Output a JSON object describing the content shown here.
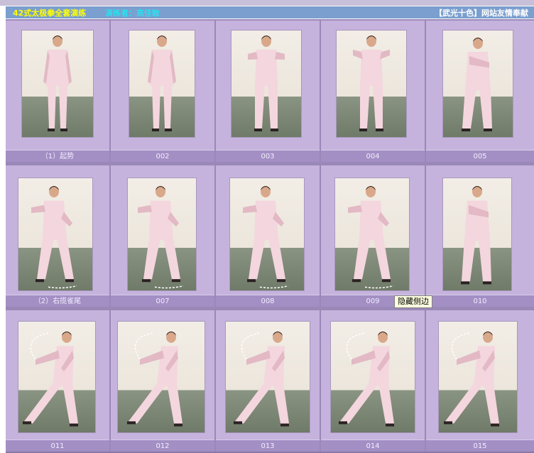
{
  "header": {
    "title": "42式太极拳全套演练",
    "performer": "演练者：高佳敏",
    "credit": "【武光十色】网站友情奉献"
  },
  "frames": [
    {
      "caption": "（1）起势",
      "pose": "stand"
    },
    {
      "caption": "002",
      "pose": "stand"
    },
    {
      "caption": "003",
      "pose": "arms-raise"
    },
    {
      "caption": "004",
      "pose": "arms-front"
    },
    {
      "caption": "005",
      "pose": "squat"
    },
    {
      "caption": "（2）右揽雀尾",
      "pose": "turn"
    },
    {
      "caption": "007",
      "pose": "turn"
    },
    {
      "caption": "008",
      "pose": "step"
    },
    {
      "caption": "009",
      "pose": "step"
    },
    {
      "caption": "010",
      "pose": "hold"
    },
    {
      "caption": "011",
      "pose": "lunge"
    },
    {
      "caption": "012",
      "pose": "lunge"
    },
    {
      "caption": "013",
      "pose": "lunge"
    },
    {
      "caption": "014",
      "pose": "lunge"
    },
    {
      "caption": "015",
      "pose": "lunge"
    }
  ],
  "tooltip": "隐藏侧边",
  "colors": {
    "header_bg": "#7b9fce",
    "title": "#ffff00",
    "performer": "#00ffff",
    "cell_bg": "#c5b3dd",
    "caption_bg": "#a38fc4"
  }
}
